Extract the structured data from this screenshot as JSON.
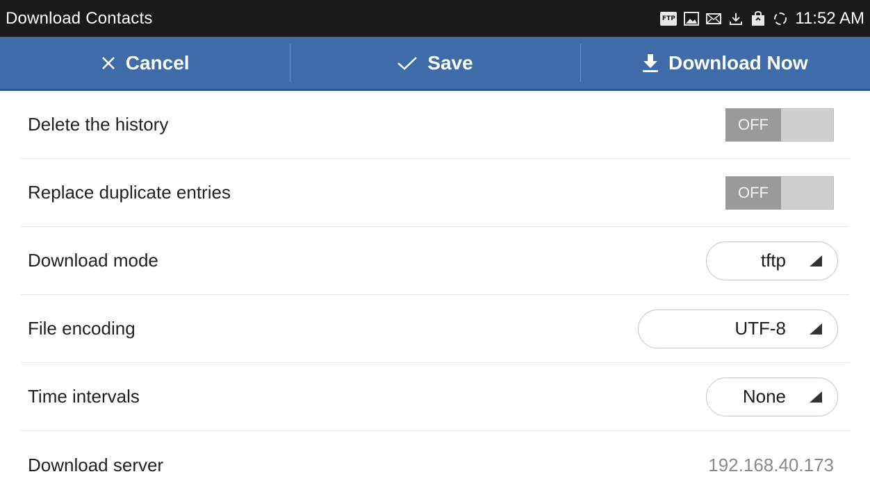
{
  "status_bar": {
    "title": "Download Contacts",
    "ftp_badge": "FTP",
    "icons": [
      "ftp-icon",
      "image-icon",
      "mail-icon",
      "download-icon",
      "shopping-bag-icon",
      "sync-icon"
    ],
    "time": "11:52 AM"
  },
  "action_bar": {
    "cancel_label": "Cancel",
    "save_label": "Save",
    "download_label": "Download Now",
    "background": "#3f6ca9"
  },
  "settings": {
    "delete_history": {
      "label": "Delete the history",
      "toggle": "OFF"
    },
    "replace_duplicates": {
      "label": "Replace duplicate entries",
      "toggle": "OFF"
    },
    "download_mode": {
      "label": "Download mode",
      "value": "tftp"
    },
    "file_encoding": {
      "label": "File encoding",
      "value": "UTF-8"
    },
    "time_intervals": {
      "label": "Time intervals",
      "value": "None"
    },
    "download_server": {
      "label": "Download server",
      "value": "192.168.40.173"
    }
  }
}
